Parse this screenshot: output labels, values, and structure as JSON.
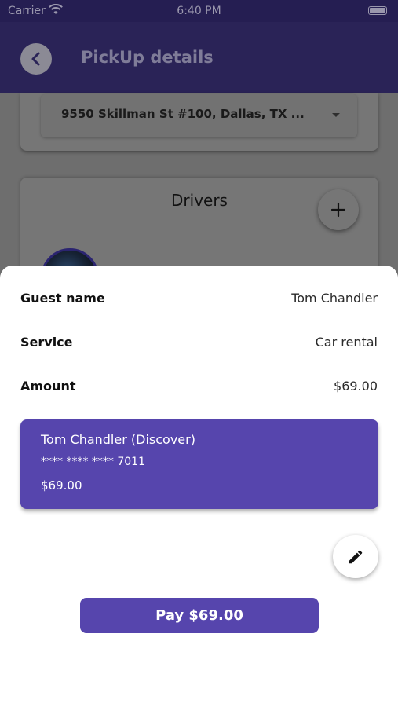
{
  "status_bar": {
    "carrier": "Carrier",
    "time": "6:40 PM"
  },
  "header": {
    "title": "PickUp details",
    "back_icon": "chevron-left-icon"
  },
  "location": {
    "selected": "9550 Skillman St #100, Dallas, TX ..."
  },
  "drivers": {
    "title": "Drivers",
    "add_icon": "plus-icon"
  },
  "summary": {
    "rows": [
      {
        "label": "Guest name",
        "value": "Tom Chandler"
      },
      {
        "label": "Service",
        "value": "Car rental"
      },
      {
        "label": "Amount",
        "value": "$69.00"
      }
    ]
  },
  "payment_card": {
    "holder": "Tom Chandler (Discover)",
    "number": "**** **** **** 7011",
    "amount": "$69.00"
  },
  "edit_icon": "pencil-icon",
  "pay_button": {
    "label": "Pay $69.00"
  },
  "colors": {
    "accent": "#5645ad",
    "header_bg": "#2a2357"
  }
}
